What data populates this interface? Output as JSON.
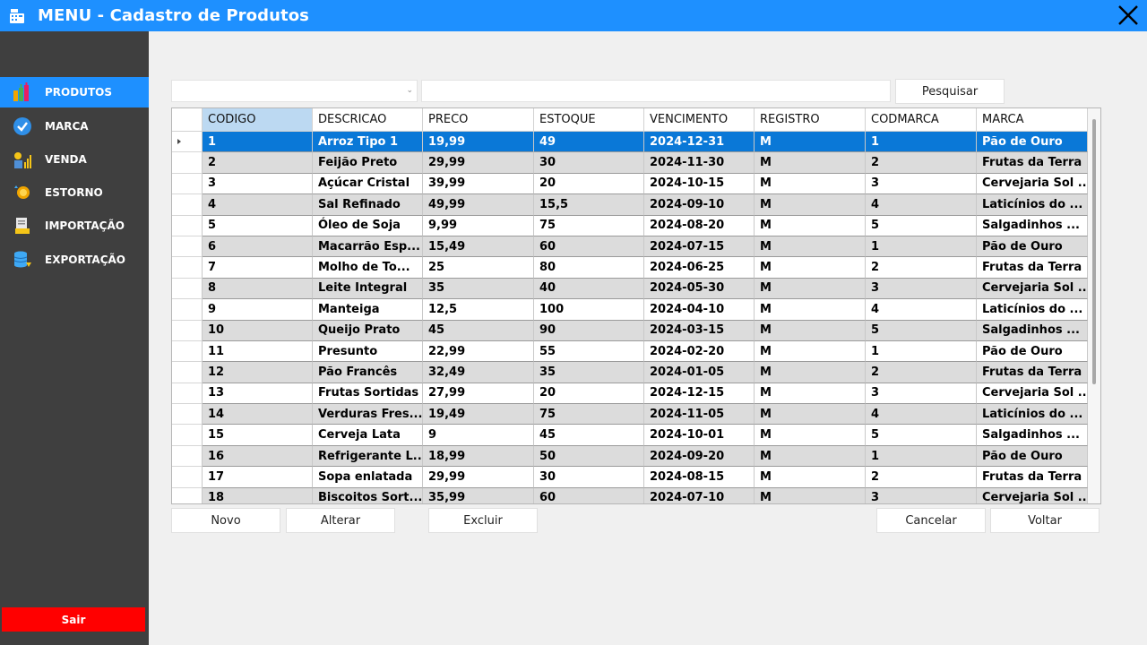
{
  "window": {
    "title": "MENU - Cadastro de Produtos"
  },
  "sidebar": {
    "items": [
      {
        "label": "PRODUTOS",
        "icon": "bottles-icon",
        "active": true
      },
      {
        "label": "MARCA",
        "icon": "check-badge-icon",
        "active": false
      },
      {
        "label": "VENDA",
        "icon": "sales-icon",
        "active": false
      },
      {
        "label": "ESTORNO",
        "icon": "coin-icon",
        "active": false
      },
      {
        "label": "IMPORTAÇÃO",
        "icon": "import-icon",
        "active": false
      },
      {
        "label": "EXPORTAÇÃO",
        "icon": "export-database-icon",
        "active": false
      }
    ],
    "exit_label": "Sair"
  },
  "search": {
    "filter_value": "",
    "query_value": "",
    "button_label": "Pesquisar"
  },
  "grid": {
    "columns": [
      "CODIGO",
      "DESCRICAO",
      "PRECO",
      "ESTOQUE",
      "VENCIMENTO",
      "REGISTRO",
      "CODMARCA",
      "MARCA"
    ],
    "selected_header": "CODIGO",
    "selected_row": 0,
    "rows": [
      [
        "1",
        "Arroz Tipo 1",
        "19,99",
        "49",
        "2024-12-31",
        "M",
        "1",
        "Pão de Ouro"
      ],
      [
        "2",
        "Feijão Preto",
        "29,99",
        "30",
        "2024-11-30",
        "M",
        "2",
        "Frutas da Terra"
      ],
      [
        "3",
        "Açúcar Cristal",
        "39,99",
        "20",
        "2024-10-15",
        "M",
        "3",
        "Cervejaria Sol ..."
      ],
      [
        "4",
        "Sal Refinado",
        "49,99",
        "15,5",
        "2024-09-10",
        "M",
        "4",
        "Laticínios do ..."
      ],
      [
        "5",
        "Óleo de Soja",
        "9,99",
        "75",
        "2024-08-20",
        "M",
        "5",
        "Salgadinhos ..."
      ],
      [
        "6",
        "Macarrão Esp...",
        "15,49",
        "60",
        "2024-07-15",
        "M",
        "1",
        "Pão de Ouro"
      ],
      [
        "7",
        "Molho de To...",
        "25",
        "80",
        "2024-06-25",
        "M",
        "2",
        "Frutas da Terra"
      ],
      [
        "8",
        "Leite Integral",
        "35",
        "40",
        "2024-05-30",
        "M",
        "3",
        "Cervejaria Sol ..."
      ],
      [
        "9",
        "Manteiga",
        "12,5",
        "100",
        "2024-04-10",
        "M",
        "4",
        "Laticínios do ..."
      ],
      [
        "10",
        "Queijo Prato",
        "45",
        "90",
        "2024-03-15",
        "M",
        "5",
        "Salgadinhos ..."
      ],
      [
        "11",
        "Presunto",
        "22,99",
        "55",
        "2024-02-20",
        "M",
        "1",
        "Pão de Ouro"
      ],
      [
        "12",
        "Pão Francês",
        "32,49",
        "35",
        "2024-01-05",
        "M",
        "2",
        "Frutas da Terra"
      ],
      [
        "13",
        "Frutas Sortidas",
        "27,99",
        "20",
        "2024-12-15",
        "M",
        "3",
        "Cervejaria Sol ..."
      ],
      [
        "14",
        "Verduras Fres...",
        "19,49",
        "75",
        "2024-11-05",
        "M",
        "4",
        "Laticínios do ..."
      ],
      [
        "15",
        "Cerveja Lata",
        "9",
        "45",
        "2024-10-01",
        "M",
        "5",
        "Salgadinhos ..."
      ],
      [
        "16",
        "Refrigerante L...",
        "18,99",
        "50",
        "2024-09-20",
        "M",
        "1",
        "Pão de Ouro"
      ],
      [
        "17",
        "Sopa enlatada",
        "29,99",
        "30",
        "2024-08-15",
        "M",
        "2",
        "Frutas da Terra"
      ],
      [
        "18",
        "Biscoitos Sort...",
        "35,99",
        "60",
        "2024-07-10",
        "M",
        "3",
        "Cervejaria Sol ..."
      ]
    ]
  },
  "actions": {
    "new_label": "Novo",
    "edit_label": "Alterar",
    "delete_label": "Excluir",
    "cancel_label": "Cancelar",
    "back_label": "Voltar"
  },
  "colors": {
    "accent": "#1e90ff",
    "sidebar_bg": "#3f3f3f",
    "selected_row": "#0a78d7",
    "alt_row": "#dcdcdc",
    "exit_button": "#ff0000"
  }
}
